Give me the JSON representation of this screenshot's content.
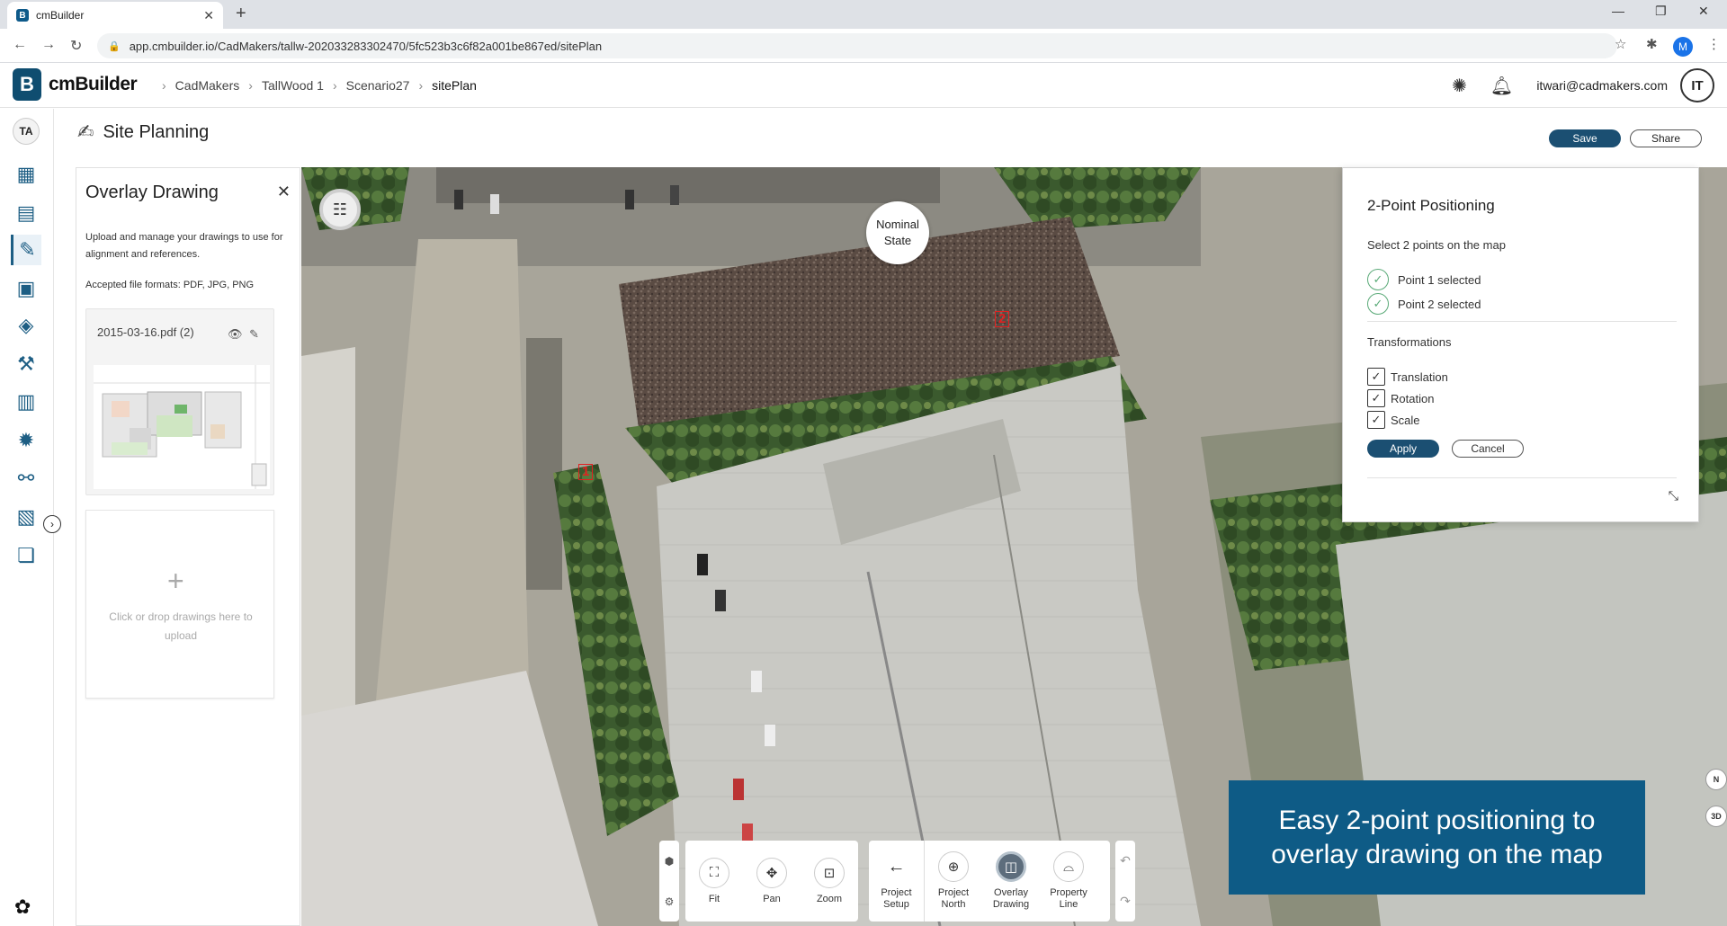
{
  "browser": {
    "tab_title": "cmBuilder",
    "tab_favicon": "B",
    "url": "app.cmbuilder.io/CadMakers/tallw-202033283302470/5fc523b3c6f82a001be867ed/sitePlan",
    "profile_initial": "M"
  },
  "header": {
    "logo_mark": "B",
    "logo_text": "cmBuilder",
    "breadcrumbs": [
      "CadMakers",
      "TallWood 1",
      "Scenario27",
      "sitePlan"
    ],
    "user_email": "itwari@cadmakers.com",
    "user_initials": "IT"
  },
  "rail": {
    "avatar": "TA",
    "items": [
      "dashboard-icon",
      "analysis-icon",
      "site-planning-icon",
      "schedule-icon",
      "layers-icon",
      "tools-icon",
      "floorplan-icon",
      "settings-icon",
      "hierarchy-icon",
      "report-icon",
      "documents-icon"
    ]
  },
  "page": {
    "title": "Site Planning",
    "save_label": "Save",
    "share_label": "Share"
  },
  "overlay_panel": {
    "title": "Overlay Drawing",
    "description": "Upload and manage your drawings to use for alignment and references.",
    "formats": "Accepted file formats: PDF, JPG, PNG",
    "file_name": "2015-03-16.pdf (2)",
    "dropzone_text": "Click or drop drawings here to upload"
  },
  "map": {
    "north_badge_line1": "Nominal",
    "north_badge_line2": "State",
    "marker1": "1",
    "marker2": "2"
  },
  "positioning_dialog": {
    "title": "2-Point Positioning",
    "subtitle": "Select 2 points on the map",
    "point1": "Point 1 selected",
    "point2": "Point 2 selected",
    "transformations_label": "Transformations",
    "translation": "Translation",
    "rotation": "Rotation",
    "scale": "Scale",
    "apply": "Apply",
    "cancel": "Cancel"
  },
  "map_controls": {
    "north_mini": "N",
    "view_3d": "3D"
  },
  "toolbar": {
    "fit": "Fit",
    "pan": "Pan",
    "zoom": "Zoom",
    "project_setup": "Project Setup",
    "project_north": "Project North",
    "overlay_drawing": "Overlay Drawing",
    "property_line": "Property Line"
  },
  "banner": {
    "text": "Easy 2-point positioning to overlay drawing on the map"
  },
  "colors": {
    "primary": "#1b4f72",
    "banner": "#0e5b86",
    "marker": "#e02020",
    "check": "#5aaa78"
  }
}
